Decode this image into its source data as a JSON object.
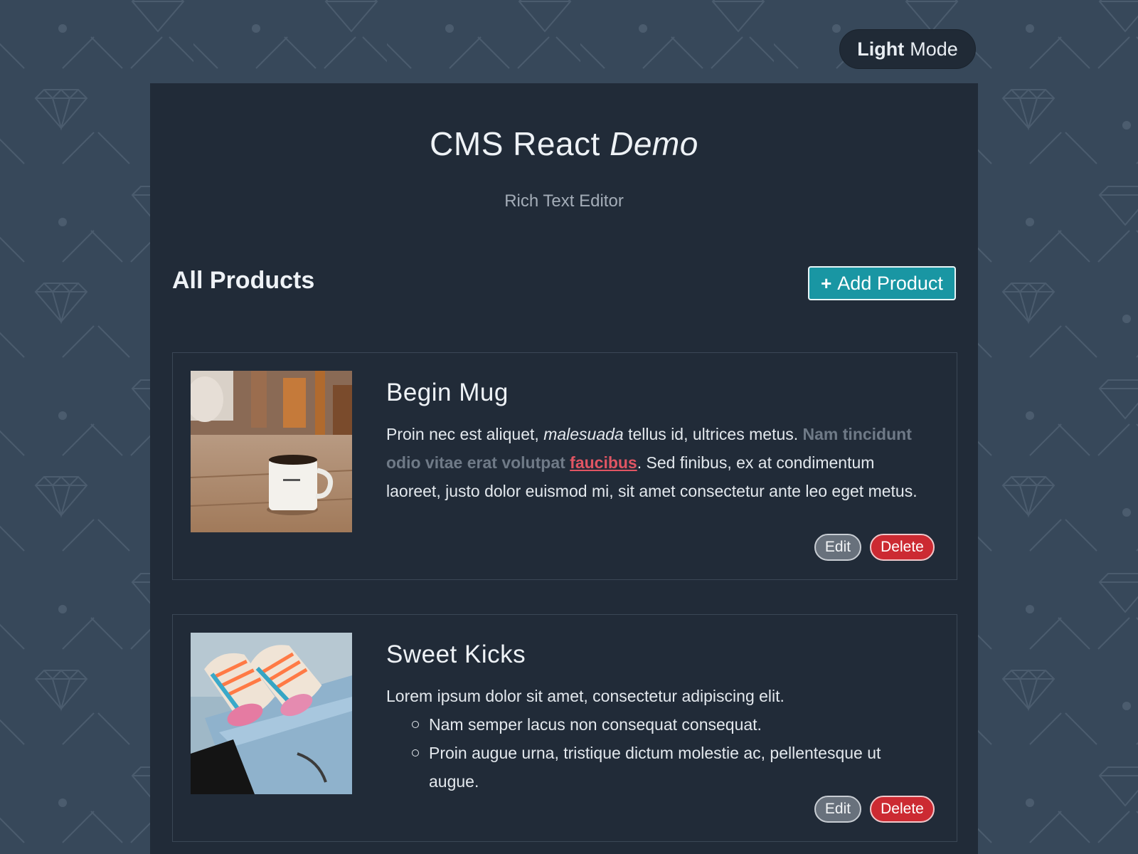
{
  "mode_toggle": {
    "strong": "Light",
    "rest": "Mode"
  },
  "header": {
    "title_main": "CMS React",
    "title_em": "Demo",
    "subtitle": "Rich Text Editor"
  },
  "section": {
    "title": "All Products",
    "add_button": {
      "icon": "+",
      "label": "Add Product"
    }
  },
  "products": [
    {
      "title": "Begin Mug",
      "image": "coffee-mug-photo",
      "description": {
        "t1": "Proin nec est aliquet, ",
        "t2_em": "malesuada",
        "t3": " tellus id, ultrices metus. ",
        "t4_muted": "Nam tincidunt odio vitae erat volutpat",
        "t5_space": " ",
        "t6_link": "faucibus",
        "t7": ". Sed finibus, ex at condimentum laoreet, justo dolor euismod mi, sit amet consectetur ante leo eget metus."
      },
      "edit_label": "Edit",
      "delete_label": "Delete"
    },
    {
      "title": "Sweet Kicks",
      "image": "sneakers-photo",
      "description": {
        "intro": "Lorem ipsum dolor sit amet, consectetur adipiscing elit.",
        "bullets": [
          "Nam semper lacus non consequat consequat.",
          "Proin augue urna, tristique dictum molestie ac, pellentesque ut augue."
        ]
      },
      "edit_label": "Edit",
      "delete_label": "Delete"
    }
  ],
  "colors": {
    "page_bg": "#37485a",
    "panel_bg": "#212b38",
    "accent": "#1996a3",
    "danger": "#cc2a32",
    "link": "#e05563"
  }
}
